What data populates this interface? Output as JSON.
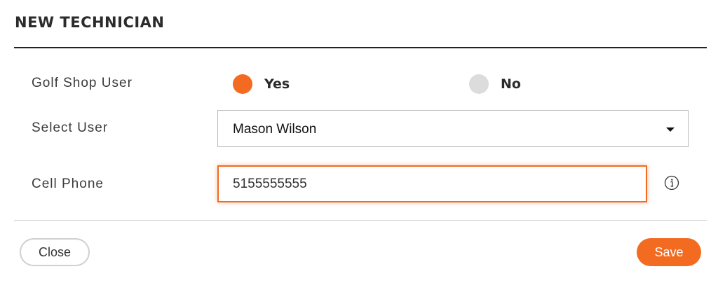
{
  "dialog": {
    "title": "NEW TECHNICIAN"
  },
  "form": {
    "golf_shop_user": {
      "label": "Golf Shop User",
      "options": [
        {
          "label": "Yes",
          "selected": true
        },
        {
          "label": "No",
          "selected": false
        }
      ]
    },
    "select_user": {
      "label": "Select User",
      "value": "Mason Wilson"
    },
    "cell_phone": {
      "label": "Cell Phone",
      "value": "5155555555",
      "info_icon": "info-circle-icon"
    }
  },
  "footer": {
    "close_label": "Close",
    "save_label": "Save"
  },
  "colors": {
    "accent": "#f26b21",
    "radio_unselected": "#dcdcdc"
  }
}
